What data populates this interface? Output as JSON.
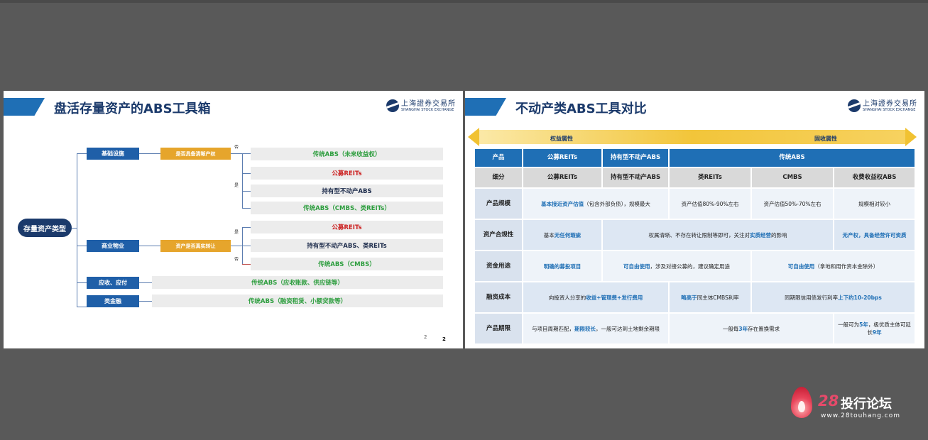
{
  "slide1": {
    "title": "盘活存量资产的ABS工具箱",
    "logo_cn": "上海證券交易所",
    "logo_en": "SHANGHAI STOCK EXCHANGE",
    "root": "存量资产类型",
    "categories": [
      "基础设施",
      "商业物业",
      "应收、应付",
      "类金融"
    ],
    "questions": [
      "是否具备清晰产权",
      "资产是否真实转让"
    ],
    "labels": {
      "no": "否",
      "yes": "是"
    },
    "results": [
      "传统ABS（未来收益权）",
      "公募REITs",
      "持有型不动产ABS",
      "传统ABS（CMBS、类REITs）",
      "公募REITs",
      "持有型不动产ABS、类REITs",
      "传统ABS（CMBS）",
      "传统ABS（应收账款、供应链等）",
      "传统ABS（融资租赁、小额贷款等）"
    ],
    "page_num": "2",
    "page_num_bold": "2"
  },
  "slide2": {
    "title": "不动产类ABS工具对比",
    "logo_cn": "上海證券交易所",
    "logo_en": "SHANGHAI STOCK EXCHANGE",
    "banner_left": "权益属性",
    "banner_right": "固收属性",
    "table": {
      "h_product": "产品",
      "h_reits": "公募REITs",
      "h_hold": "持有型不动产ABS",
      "h_trad": "传统ABS",
      "h_sub": "细分",
      "s_reits": "公募REITs",
      "s_hold": "持有型不动产ABS",
      "s_lreits": "类REITs",
      "s_cmbs": "CMBS",
      "s_fee": "收费收益权ABS",
      "r_scale": "产品规模",
      "scale_a1": "基本接近资产估值",
      "scale_a2": "（包含外部负债），规模最大",
      "scale_b": "资产估值80%-90%左右",
      "scale_c": "资产估值50%-70%左右",
      "scale_d": "规模相对较小",
      "r_comp": "资产合规性",
      "comp_a1": "基本",
      "comp_a2": "无任何瑕疵",
      "comp_b1": "权属清晰、不存在转让限制等即可，关注对",
      "comp_b2": "实质经营",
      "comp_b3": "的影响",
      "comp_c": "无产权，具备经营许可资质",
      "r_use": "资金用途",
      "use_a": "明确的募投项目",
      "use_b1": "可自由使用",
      "use_b2": "，涉及对接公募的，建议确定用途",
      "use_c1": "可自由使用",
      "use_c2": "（拿地和用作资本金除外）",
      "r_cost": "融资成本",
      "cost_a1": "向投资人分享的",
      "cost_a2": "收益+管理费+发行费用",
      "cost_b1": "略高于",
      "cost_b2": "同主体CMBS利率",
      "cost_c1": "同期限信用债发行利率",
      "cost_c2": "上下约10-20bps",
      "r_term": "产品期限",
      "term_a1": "与项目周期匹配，",
      "term_a2": "期限较长",
      "term_a3": "，一般可达到土地剩余期限",
      "term_b1": "一般每",
      "term_b2": "3年",
      "term_b3": "存在置换需求",
      "term_c1": "一般可为",
      "term_c2": "5年",
      "term_c3": "，极优质主体可延长",
      "term_c4": "9年"
    }
  },
  "watermark": {
    "num": "28",
    "cn": "投行论坛",
    "url": "www.28touhang.com"
  },
  "colors": {
    "background": "#595959",
    "navy": "#1b3a6b",
    "blue": "#1f6fb5",
    "gold": "#f1c232",
    "green": "#2e9e3f",
    "red": "#cc2222"
  }
}
